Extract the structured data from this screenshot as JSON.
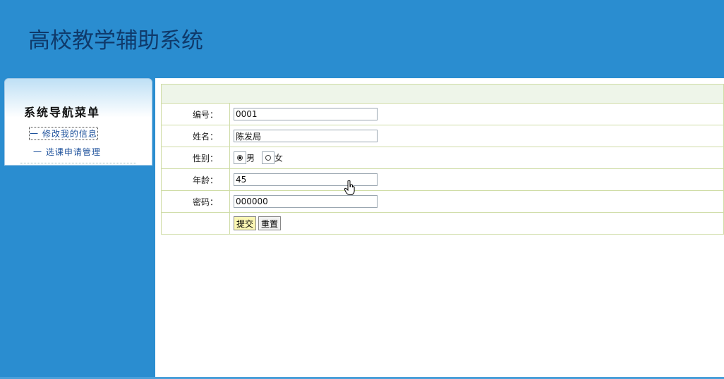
{
  "header": {
    "title": "高校教学辅助系统"
  },
  "sidebar": {
    "title": "系统导航菜单",
    "items": [
      {
        "label": "一 修改我的信息",
        "active": true
      },
      {
        "label": "一 选课申请管理",
        "active": false
      }
    ]
  },
  "form": {
    "fields": {
      "id": {
        "label": "编号：",
        "value": "0001"
      },
      "name": {
        "label": "姓名：",
        "value": "陈发局"
      },
      "gender": {
        "label": "性别：",
        "options": [
          "男",
          "女"
        ],
        "selected": "男"
      },
      "age": {
        "label": "年龄：",
        "value": "45"
      },
      "password": {
        "label": "密码：",
        "value": "000000"
      }
    },
    "buttons": {
      "submit": "提交",
      "reset": "重置"
    }
  },
  "icons": {
    "cursor": "hand-pointer-icon"
  },
  "colors": {
    "background": "#2a8dd0",
    "title": "#0f3a6b",
    "nav_link": "#1b4f9a",
    "table_border": "#cfdca6",
    "submit_button": "#fbf6b4"
  }
}
